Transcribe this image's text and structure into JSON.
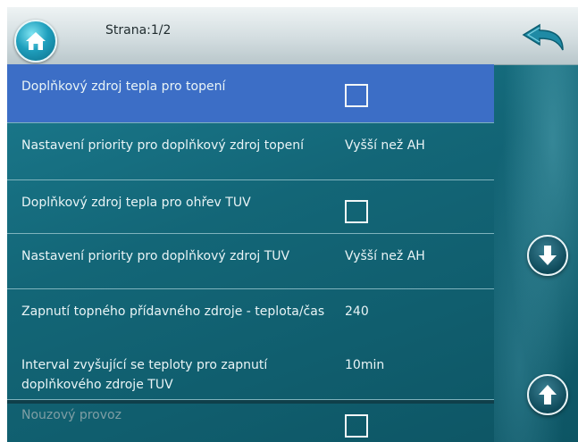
{
  "header": {
    "page_label": "Strana:1/2",
    "home_icon": "home-icon",
    "back_icon": "back-arrow-icon"
  },
  "rows": [
    {
      "label": "Doplňkový zdroj tepla pro topení",
      "type": "checkbox",
      "checked": false,
      "selected": true
    },
    {
      "label": "Nastavení priority pro doplňkový zdroj topení",
      "type": "value",
      "value": "Vyšší než AH"
    },
    {
      "label": "Doplňkový zdroj tepla pro ohřev TUV",
      "type": "checkbox",
      "checked": false
    },
    {
      "label": "Nastavení priority pro doplňkový zdroj TUV",
      "type": "value",
      "value": "Vyšší než AH"
    },
    {
      "label": "Zapnutí topného přídavného zdroje - teplota/čas",
      "type": "value",
      "value": "240"
    },
    {
      "label": "Interval zvyšující se teploty pro zapnutí doplňkového zdroje TUV",
      "type": "value",
      "value": "10min"
    },
    {
      "label": "Nouzový provoz",
      "type": "checkbox",
      "checked": false,
      "disabled": true
    }
  ],
  "nav": {
    "scroll_down_icon": "arrow-down-icon",
    "scroll_up_icon": "arrow-up-icon"
  },
  "colors": {
    "selected_row": "#3c6ec6",
    "background": "#136677",
    "header": "#d3dde0"
  }
}
